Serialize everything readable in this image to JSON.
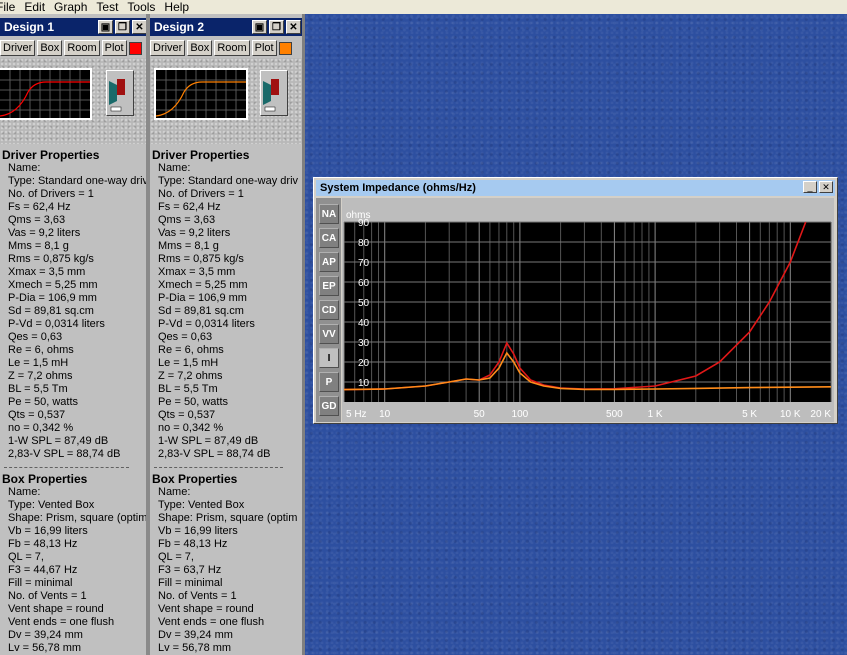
{
  "menu": [
    "File",
    "Edit",
    "Graph",
    "Test",
    "Tools",
    "Help"
  ],
  "designs": [
    {
      "title": "Design 1",
      "tabs": [
        "Driver",
        "Box",
        "Room",
        "Plot"
      ],
      "color": "#ff0000",
      "driver_header": "Driver Properties",
      "driver": [
        "Name:",
        "Type: Standard one-way driv",
        "No. of Drivers = 1",
        "Fs = 62,4 Hz",
        "Qms = 3,63",
        "Vas = 9,2 liters",
        "Mms = 8,1 g",
        "Rms = 0,875 kg/s",
        "Xmax = 3,5 mm",
        "Xmech = 5,25 mm",
        "P-Dia = 106,9 mm",
        "Sd = 89,81 sq.cm",
        "P-Vd = 0,0314 liters",
        "Qes = 0,63",
        "Re = 6, ohms",
        "Le = 1,5 mH",
        "Z = 7,2 ohms",
        "BL = 5,5 Tm",
        "Pe = 50, watts",
        "Qts = 0,537",
        "no = 0,342 %",
        "1-W SPL = 87,49 dB",
        "2,83-V SPL = 88,74 dB"
      ],
      "box_header": "Box Properties",
      "box": [
        "Name:",
        "Type: Vented Box",
        "Shape: Prism, square (optim",
        "Vb = 16,99 liters",
        "Fb = 48,13 Hz",
        "QL = 7,",
        "F3 = 44,67 Hz",
        "Fill = minimal",
        "No. of Vents = 1",
        "Vent shape = round",
        "Vent ends = one flush",
        "Dv = 39,24 mm",
        "Lv = 56,78 mm"
      ]
    },
    {
      "title": "Design 2",
      "tabs": [
        "Driver",
        "Box",
        "Room",
        "Plot"
      ],
      "color": "#ff8000",
      "driver_header": "Driver Properties",
      "driver": [
        "Name:",
        "Type: Standard one-way driv",
        "No. of Drivers = 1",
        "Fs = 62,4 Hz",
        "Qms = 3,63",
        "Vas = 9,2 liters",
        "Mms = 8,1 g",
        "Rms = 0,875 kg/s",
        "Xmax = 3,5 mm",
        "Xmech = 5,25 mm",
        "P-Dia = 106,9 mm",
        "Sd = 89,81 sq.cm",
        "P-Vd = 0,0314 liters",
        "Qes = 0,63",
        "Re = 6, ohms",
        "Le = 1,5 mH",
        "Z = 7,2 ohms",
        "BL = 5,5 Tm",
        "Pe = 50, watts",
        "Qts = 0,537",
        "no = 0,342 %",
        "1-W SPL = 87,49 dB",
        "2,83-V SPL = 88,74 dB"
      ],
      "box_header": "Box Properties",
      "box": [
        "Name:",
        "Type: Vented Box",
        "Shape: Prism, square (optim",
        "Vb = 16,99 liters",
        "Fb = 48,13 Hz",
        "QL = 7,",
        "F3 = 63,7 Hz",
        "Fill = minimal",
        "No. of Vents = 1",
        "Vent shape = round",
        "Vent ends = one flush",
        "Dv = 39,24 mm",
        "Lv = 56,78 mm"
      ]
    }
  ],
  "graph_window": {
    "title": "System Impedance (ohms/Hz)",
    "side_buttons": [
      "NA",
      "CA",
      "AP",
      "EP",
      "CD",
      "VV",
      "I",
      "P",
      "GD"
    ],
    "active_button": "I"
  },
  "chart_data": {
    "type": "line",
    "title": "System Impedance (ohms/Hz)",
    "xlabel": "",
    "ylabel": "ohms",
    "xscale": "log",
    "xlim": [
      5,
      20000
    ],
    "ylim": [
      0,
      90
    ],
    "x_tick_labels": [
      "5 Hz",
      "10",
      "50",
      "100",
      "500",
      "1 K",
      "5 K",
      "10 K",
      "20 K"
    ],
    "x_tick_values": [
      5,
      10,
      50,
      100,
      500,
      1000,
      5000,
      10000,
      20000
    ],
    "y_tick_labels": [
      "10",
      "20",
      "30",
      "40",
      "50",
      "60",
      "70",
      "80",
      "90"
    ],
    "y_tick_values": [
      10,
      20,
      30,
      40,
      50,
      60,
      70,
      80,
      90
    ],
    "grid": true,
    "series": [
      {
        "color": "#e01818",
        "x": [
          5,
          10,
          20,
          30,
          40,
          50,
          60,
          70,
          80,
          90,
          100,
          120,
          150,
          200,
          300,
          500,
          1000,
          2000,
          3000,
          5000,
          7000,
          10000,
          13000
        ],
        "y": [
          6.2,
          6.5,
          8.0,
          10.0,
          11.5,
          11.0,
          13.5,
          20.0,
          29.5,
          24.0,
          17.0,
          11.0,
          8.5,
          7.0,
          6.5,
          6.6,
          8.0,
          13.0,
          20.0,
          35.0,
          50.0,
          70.0,
          90.0
        ]
      },
      {
        "color": "#ff8c1a",
        "x": [
          5,
          10,
          20,
          30,
          40,
          50,
          60,
          70,
          80,
          90,
          100,
          120,
          150,
          200,
          300,
          500,
          1000,
          2000,
          5000,
          10000,
          20000
        ],
        "y": [
          6.2,
          6.5,
          8.0,
          10.0,
          11.5,
          11.0,
          12.0,
          17.0,
          24.5,
          20.0,
          14.5,
          10.0,
          8.0,
          6.8,
          6.3,
          6.3,
          6.5,
          6.8,
          7.2,
          7.4,
          7.6
        ]
      }
    ]
  }
}
